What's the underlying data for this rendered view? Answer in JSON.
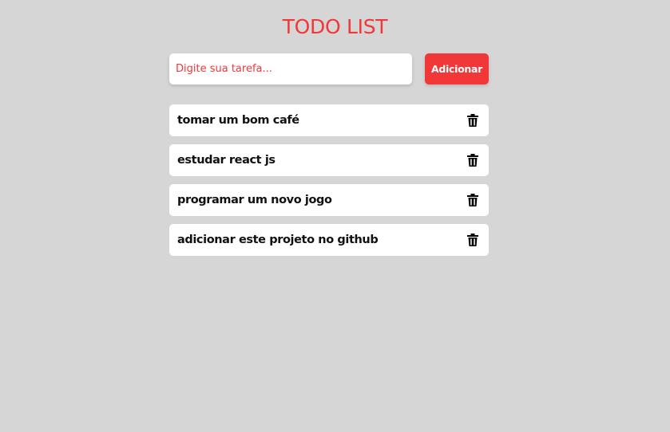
{
  "header": {
    "title": "TODO LIST"
  },
  "form": {
    "input_value": "",
    "input_placeholder": "Digite sua tarefa...",
    "add_label": "Adicionar"
  },
  "tasks": [
    {
      "text": "tomar um bom café",
      "icon": "trash-icon"
    },
    {
      "text": "estudar react js",
      "icon": "trash-icon"
    },
    {
      "text": "programar um novo jogo",
      "icon": "trash-icon"
    },
    {
      "text": "adicionar este projeto no github",
      "icon": "trash-icon"
    }
  ],
  "colors": {
    "background": "#d6d6d6",
    "accent": "#f23738",
    "card": "#ffffff",
    "text": "#111111"
  }
}
